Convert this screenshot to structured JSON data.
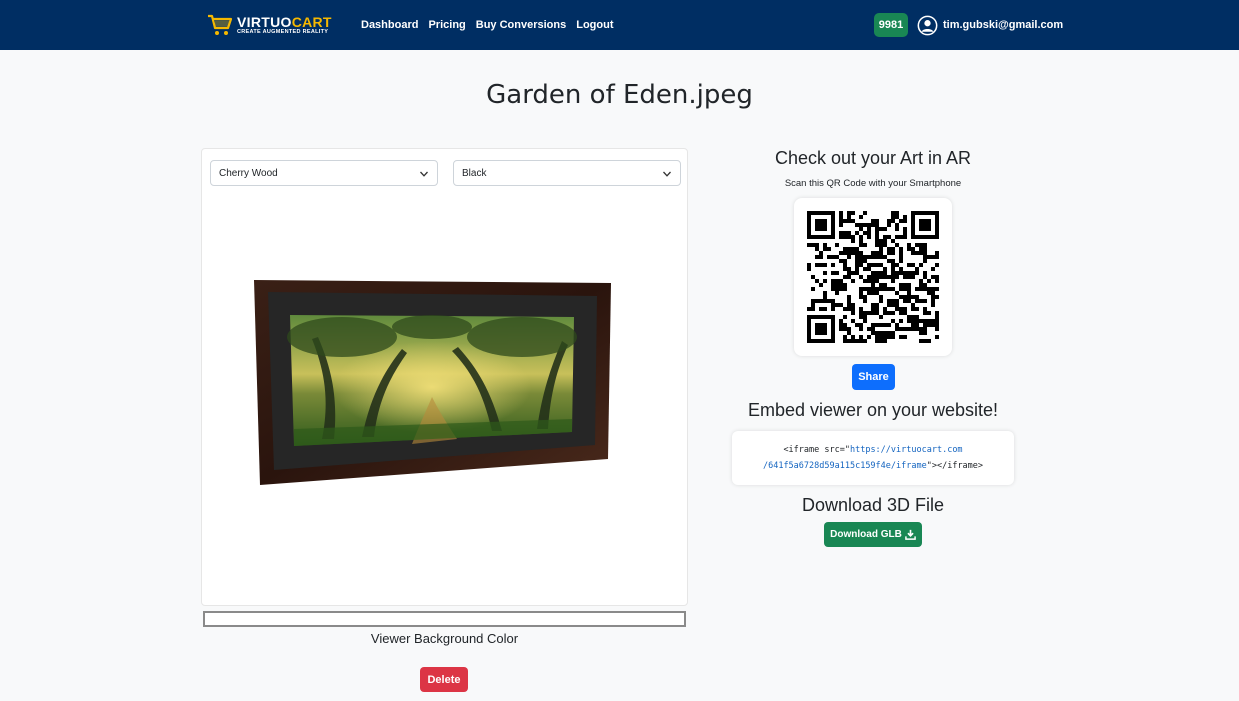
{
  "brand": {
    "name_part1": "VIRTUO",
    "name_part2": "CART",
    "tagline": "CREATE AUGMENTED REALITY",
    "accent_color": "#f5b800"
  },
  "nav": {
    "links": [
      "Dashboard",
      "Pricing",
      "Buy Conversions",
      "Logout"
    ],
    "credits": "9981",
    "user_email": "tim.gubski@gmail.com",
    "bar_color": "#002e63"
  },
  "page": {
    "title": "Garden of Eden.jpeg"
  },
  "viewer": {
    "frame_select": {
      "selected": "Cherry Wood"
    },
    "mat_select": {
      "selected": "Black"
    },
    "background_color_label": "Viewer Background Color",
    "delete_label": "Delete"
  },
  "ar_panel": {
    "heading": "Check out your Art in AR",
    "subheading": "Scan this QR Code with your Smartphone",
    "share_label": "Share",
    "embed_heading": "Embed viewer on your website!",
    "embed_code_prefix": "<iframe src=\"",
    "embed_url_line1": "https://virtuocart.com",
    "embed_url_line2": "/641f5a6728d59a115c159f4e/iframe",
    "embed_code_suffix": "\"></iframe>",
    "download_heading": "Download 3D File",
    "download_label": "Download GLB"
  },
  "icons": {
    "brand": "shopping-cart-icon",
    "user": "user-circle-icon",
    "select": "chevron-down-icon",
    "download": "download-icon"
  }
}
